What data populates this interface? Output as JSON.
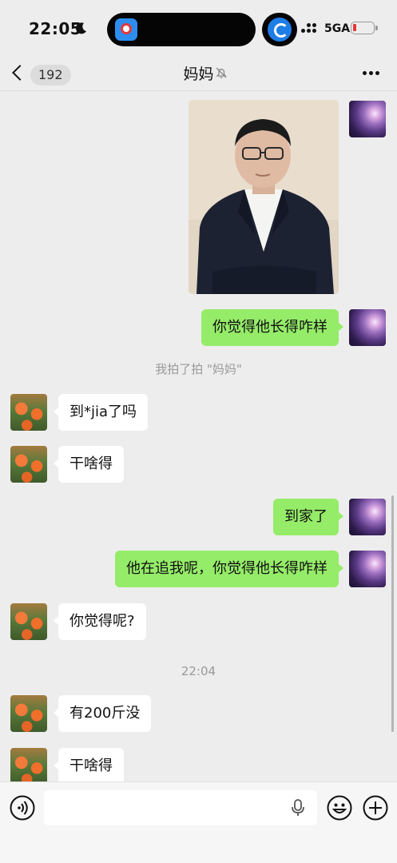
{
  "status_bar": {
    "time": "22:05",
    "network": "5GA",
    "battery_color": "#e53935"
  },
  "nav": {
    "back_count": "192",
    "title": "妈妈",
    "mute_icon": "bell-off-icon",
    "more_icon": "more-dots-icon"
  },
  "messages": {
    "m1": "你觉得他长得咋样",
    "sys1": "我拍了拍 \"妈妈\"",
    "m2": "到*jia了吗",
    "m3": "干啥得",
    "m4": "到家了",
    "m5": "他在追我呢，你觉得他长得咋样",
    "m6": "你觉得呢?",
    "time1": "22:04",
    "m7": "有200斤没",
    "m8": "干啥得"
  },
  "input": {
    "placeholder": ""
  },
  "colors": {
    "my_bubble": "#95ec69",
    "other_bubble": "#ffffff",
    "background": "#ededed"
  }
}
